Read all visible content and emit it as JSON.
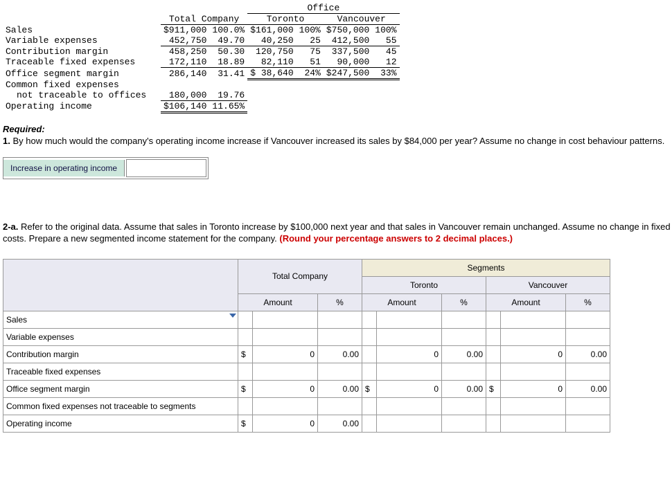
{
  "top_table": {
    "office_hdr": "Office",
    "cols": [
      "",
      "Total Company",
      "",
      "Toronto",
      "",
      "Vancouver",
      ""
    ],
    "rows": [
      {
        "label": "Sales",
        "tc": "$911,000",
        "tcp": "100.0%",
        "to": "$161,000",
        "top": "100%",
        "va": "$750,000",
        "vap": "100%"
      },
      {
        "label": "Variable expenses",
        "tc": "452,750",
        "tcp": "49.70",
        "to": "40,250",
        "top": "25",
        "va": "412,500",
        "vap": "55"
      },
      {
        "label": "Contribution margin",
        "tc": "458,250",
        "tcp": "50.30",
        "to": "120,750",
        "top": "75",
        "va": "337,500",
        "vap": "45"
      },
      {
        "label": "Traceable fixed expenses",
        "tc": "172,110",
        "tcp": "18.89",
        "to": "82,110",
        "top": "51",
        "va": "90,000",
        "vap": "12"
      },
      {
        "label": "Office segment margin",
        "tc": "286,140",
        "tcp": "31.41",
        "to": "$ 38,640",
        "top": "24%",
        "va": "$247,500",
        "vap": "33%"
      },
      {
        "label": "Common fixed expenses",
        "sub": "not traceable to offices",
        "tc": "180,000",
        "tcp": "19.76"
      },
      {
        "label": "Operating income",
        "tc": "$106,140",
        "tcp": "11.65%"
      }
    ]
  },
  "q1": {
    "heading": "Required:",
    "num": "1.",
    "text": " By how much would the company's operating income increase if Vancouver increased its sales by $84,000 per year? Assume no change in cost behaviour patterns.",
    "box_label": "Increase in operating income"
  },
  "q2": {
    "num": "2-a.",
    "text": " Refer to the original data. Assume that sales in Toronto increase by $100,000 next year and that sales in Vancouver remain unchanged. Assume no change in fixed costs. Prepare a new segmented income statement for the company.",
    "bold_red": " (Round your percentage answers to 2 decimal places.)"
  },
  "tbl2": {
    "seg_hdr": "Segments",
    "group_cols": [
      "Total Company",
      "Toronto",
      "Vancouver"
    ],
    "sub_cols": [
      "Amount",
      "%"
    ],
    "rows": [
      "Sales",
      "Variable expenses",
      "Contribution margin",
      "Traceable fixed expenses",
      "Office segment margin",
      "Common fixed expenses not traceable to segments",
      "Operating income"
    ],
    "auto": {
      "cm": {
        "cur": "$",
        "amt": "0",
        "pct": "0.00"
      },
      "osm": {
        "cur": "$",
        "amt": "0",
        "pct": "0.00"
      },
      "oi": {
        "cur": "$",
        "amt": "0",
        "pct": "0.00"
      }
    }
  }
}
